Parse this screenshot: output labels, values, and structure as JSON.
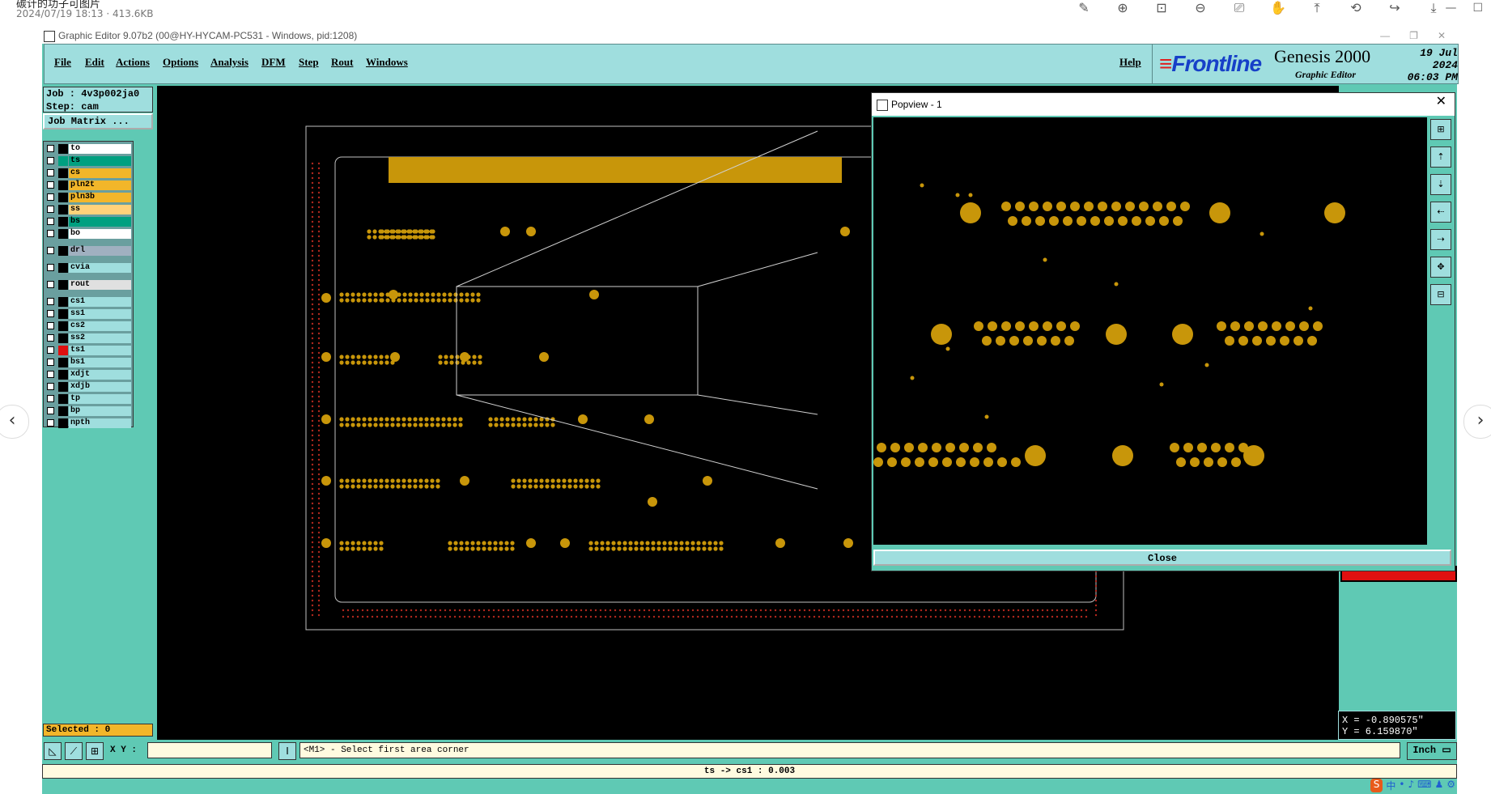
{
  "viewer": {
    "title": "碳计的功子可图片",
    "subtitle": "2024/07/19 18:13 · 413.6KB",
    "tools": [
      "✎",
      "⊕",
      "⊡",
      "⊖",
      "⎚",
      "✋",
      "⤒",
      "⟲",
      "↪",
      "⤓"
    ],
    "win_controls": [
      "—",
      "☐"
    ],
    "prev": "‹",
    "next": "›"
  },
  "window": {
    "title": "Graphic Editor 9.07b2 (00@HY-HYCAM-PC531 - Windows, pid:1208)",
    "controls": [
      "—",
      "❐",
      "✕"
    ]
  },
  "menu": {
    "items": [
      "File",
      "Edit",
      "Actions",
      "Options",
      "Analysis",
      "DFM",
      "Step",
      "Rout",
      "Windows"
    ],
    "help": "Help"
  },
  "brand": {
    "logo": "Frontline",
    "name": "Genesis 2000",
    "sub": "Graphic Editor",
    "date": "19 Jul 2024",
    "time": "06:03 PM"
  },
  "job": {
    "job": "Job : 4v3p002ja0",
    "step": "Step: cam",
    "matrix_button": "Job Matrix ..."
  },
  "layers": [
    {
      "name": "to",
      "color": "#ffffff",
      "swatch": "#000000",
      "gap": false
    },
    {
      "name": "ts",
      "color": "#00a080",
      "swatch": "#00a080",
      "gap": false
    },
    {
      "name": "cs",
      "color": "#f2b62a",
      "swatch": "#000000",
      "gap": false
    },
    {
      "name": "pln2t",
      "color": "#f2b62a",
      "swatch": "#000000",
      "gap": false
    },
    {
      "name": "pln3b",
      "color": "#f2b62a",
      "swatch": "#000000",
      "gap": false
    },
    {
      "name": "ss",
      "color": "#ffd27a",
      "swatch": "#000000",
      "gap": false
    },
    {
      "name": "bs",
      "color": "#00a080",
      "swatch": "#000000",
      "gap": false
    },
    {
      "name": "bo",
      "color": "#ffffff",
      "swatch": "#000000",
      "gap": false
    },
    {
      "name": "drl",
      "color": "#a0b0c0",
      "swatch": "#000000",
      "gap": true
    },
    {
      "name": "cvia",
      "color": "#9fdede",
      "swatch": "#000000",
      "gap": true
    },
    {
      "name": "rout",
      "color": "#e0e0e0",
      "swatch": "#000000",
      "gap": true
    },
    {
      "name": "cs1",
      "color": "#9fdede",
      "swatch": "#000000",
      "gap": true
    },
    {
      "name": "ss1",
      "color": "#9fdede",
      "swatch": "#000000",
      "gap": false
    },
    {
      "name": "cs2",
      "color": "#9fdede",
      "swatch": "#000000",
      "gap": false
    },
    {
      "name": "ss2",
      "color": "#9fdede",
      "swatch": "#000000",
      "gap": false
    },
    {
      "name": "ts1",
      "color": "#9fdede",
      "swatch": "#e01010",
      "gap": false
    },
    {
      "name": "bs1",
      "color": "#9fdede",
      "swatch": "#000000",
      "gap": false
    },
    {
      "name": "xdjt",
      "color": "#9fdede",
      "swatch": "#000000",
      "gap": false
    },
    {
      "name": "xdjb",
      "color": "#9fdede",
      "swatch": "#000000",
      "gap": false
    },
    {
      "name": "tp",
      "color": "#9fdede",
      "swatch": "#000000",
      "gap": false
    },
    {
      "name": "bp",
      "color": "#9fdede",
      "swatch": "#000000",
      "gap": false
    },
    {
      "name": "npth",
      "color": "#9fdede",
      "swatch": "#000000",
      "gap": false
    }
  ],
  "selected": "Selected : 0",
  "coords": {
    "x": "X = -0.890575\"",
    "y": "Y =  6.159870\""
  },
  "bottom": {
    "xy_label": "X Y :",
    "xy_value": "",
    "prompt": "<M1> - Select first area corner",
    "units": "Inch ▭",
    "status": "ts -> cs1 : 0.003"
  },
  "popview": {
    "title": "Popview - 1",
    "close": "Close",
    "x": "✕"
  },
  "ime": [
    "S",
    "中",
    "•",
    "♪",
    "⌨",
    "♟",
    "⚙"
  ],
  "colors": {
    "pad": "#c8960a",
    "outline": "#c0c0c0",
    "redvia": "#b0281e"
  }
}
